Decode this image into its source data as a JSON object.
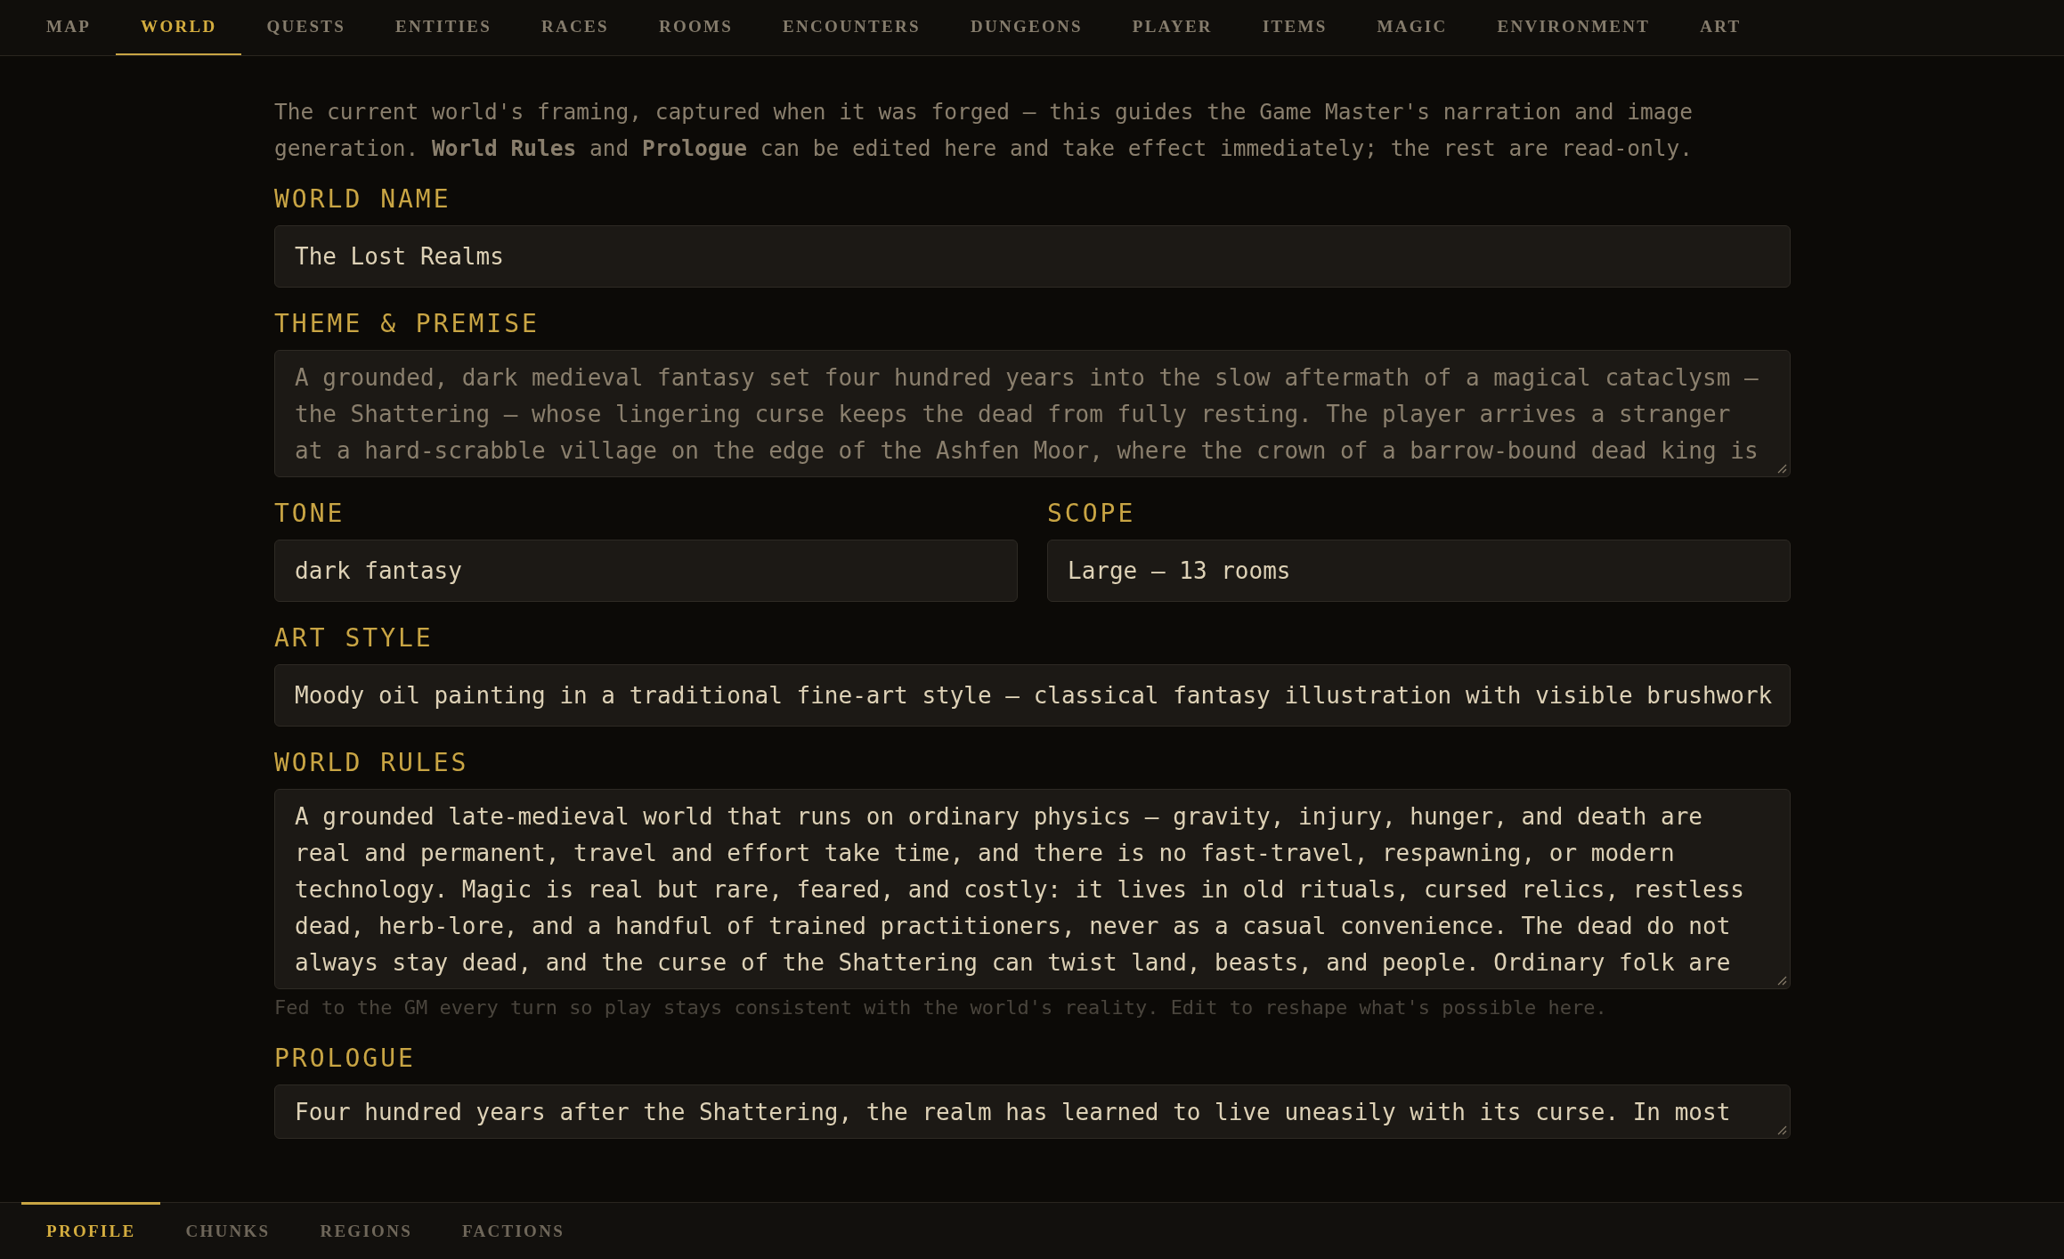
{
  "nav": {
    "tabs": [
      {
        "label": "MAP",
        "selected": false
      },
      {
        "label": "WORLD",
        "selected": true
      },
      {
        "label": "QUESTS",
        "selected": false
      },
      {
        "label": "ENTITIES",
        "selected": false
      },
      {
        "label": "RACES",
        "selected": false
      },
      {
        "label": "ROOMS",
        "selected": false
      },
      {
        "label": "ENCOUNTERS",
        "selected": false
      },
      {
        "label": "DUNGEONS",
        "selected": false
      },
      {
        "label": "PLAYER",
        "selected": false
      },
      {
        "label": "ITEMS",
        "selected": false
      },
      {
        "label": "MAGIC",
        "selected": false
      },
      {
        "label": "ENVIRONMENT",
        "selected": false
      },
      {
        "label": "ART",
        "selected": false
      }
    ]
  },
  "intro": "The current world's framing, captured when it was forged — this guides the Game Master's narration and image generation. **World Rules** and **Prologue** can be edited here and take effect immediately; the rest are read-only.",
  "fields": [
    {
      "kind": "input",
      "label": "WORLD NAME",
      "value": "The Lost Realms",
      "disabled": false
    },
    {
      "kind": "textarea",
      "label": "THEME & PREMISE",
      "value": "A grounded, dark medieval fantasy set four hundred years into the slow aftermath of a magical cataclysm —\nthe Shattering — whose lingering curse keeps the dead from fully resting. The player arrives a stranger\nat a hard-scrabble village on the edge of the Ashfen Moor, where the crown of a barrow-bound dead king is",
      "disabled": true
    },
    {
      "kind": "pair",
      "items": [
        {
          "label": "TONE",
          "value": "dark fantasy",
          "disabled": false
        },
        {
          "label": "SCOPE",
          "value": "Large — 13 rooms",
          "disabled": false
        }
      ]
    },
    {
      "kind": "input",
      "label": "ART STYLE",
      "value": "Moody oil painting in a traditional fine-art style — classical fantasy illustration with visible brushwork",
      "disabled": false
    },
    {
      "kind": "textarea",
      "label": "WORLD RULES",
      "value": "A grounded late-medieval world that runs on ordinary physics — gravity, injury, hunger, and death are\nreal and permanent, travel and effort take time, and there is no fast-travel, respawning, or modern\ntechnology. Magic is real but rare, feared, and costly: it lives in old rituals, cursed relics, restless\ndead, herb-lore, and a handful of trained practitioners, never as a casual convenience. The dead do not\nalways stay dead, and the curse of the Shattering can twist land, beasts, and people. Ordinary folk are",
      "disabled": false,
      "hint": "Fed to the GM every turn so play stays consistent with the world's reality. Edit to reshape what's possible here."
    },
    {
      "kind": "textarea",
      "label": "PROLOGUE",
      "value": "Four hundred years after the Shattering, the realm has learned to live uneasily with its curse. In most",
      "disabled": false
    }
  ],
  "bottom_tabs": [
    {
      "label": "PROFILE",
      "selected": true
    },
    {
      "label": "CHUNKS",
      "selected": false
    },
    {
      "label": "REGIONS",
      "selected": false
    },
    {
      "label": "FACTIONS",
      "selected": false
    }
  ]
}
